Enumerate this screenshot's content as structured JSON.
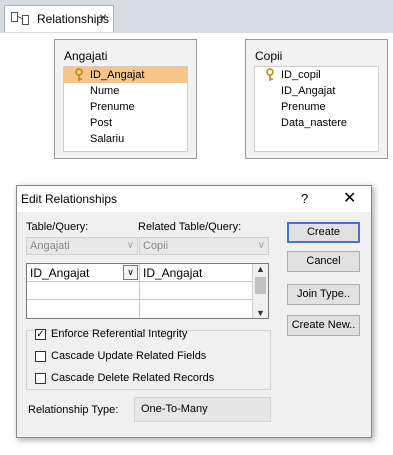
{
  "tab": {
    "label": "Relationships",
    "close": "×"
  },
  "tables": [
    {
      "title": "Angajati",
      "fields": [
        {
          "name": "ID_Angajat",
          "key": true,
          "selected": true
        },
        {
          "name": "Nume"
        },
        {
          "name": "Prenume"
        },
        {
          "name": "Post"
        },
        {
          "name": "Salariu"
        }
      ]
    },
    {
      "title": "Copii",
      "fields": [
        {
          "name": "ID_copil",
          "key": true
        },
        {
          "name": "ID_Angajat"
        },
        {
          "name": "Prenume"
        },
        {
          "name": "Data_nastere"
        }
      ]
    }
  ],
  "dialog": {
    "title": "Edit Relationships",
    "help": "?",
    "close": "✕",
    "table_query_label": "Table/Query:",
    "related_table_label": "Related Table/Query:",
    "table_value": "Angajati",
    "related_value": "Copii",
    "grid": {
      "left_field": "ID_Angajat",
      "right_field": "ID_Angajat"
    },
    "enforce_label": "Enforce Referential Integrity",
    "enforce_checked": true,
    "cascade_update_label": "Cascade Update Related Fields",
    "cascade_update_checked": false,
    "cascade_delete_label": "Cascade Delete Related Records",
    "cascade_delete_checked": false,
    "relationship_type_label": "Relationship Type:",
    "relationship_type_value": "One-To-Many",
    "buttons": {
      "create": "Create",
      "cancel": "Cancel",
      "join_type": "Join Type..",
      "create_new": "Create New.."
    }
  }
}
